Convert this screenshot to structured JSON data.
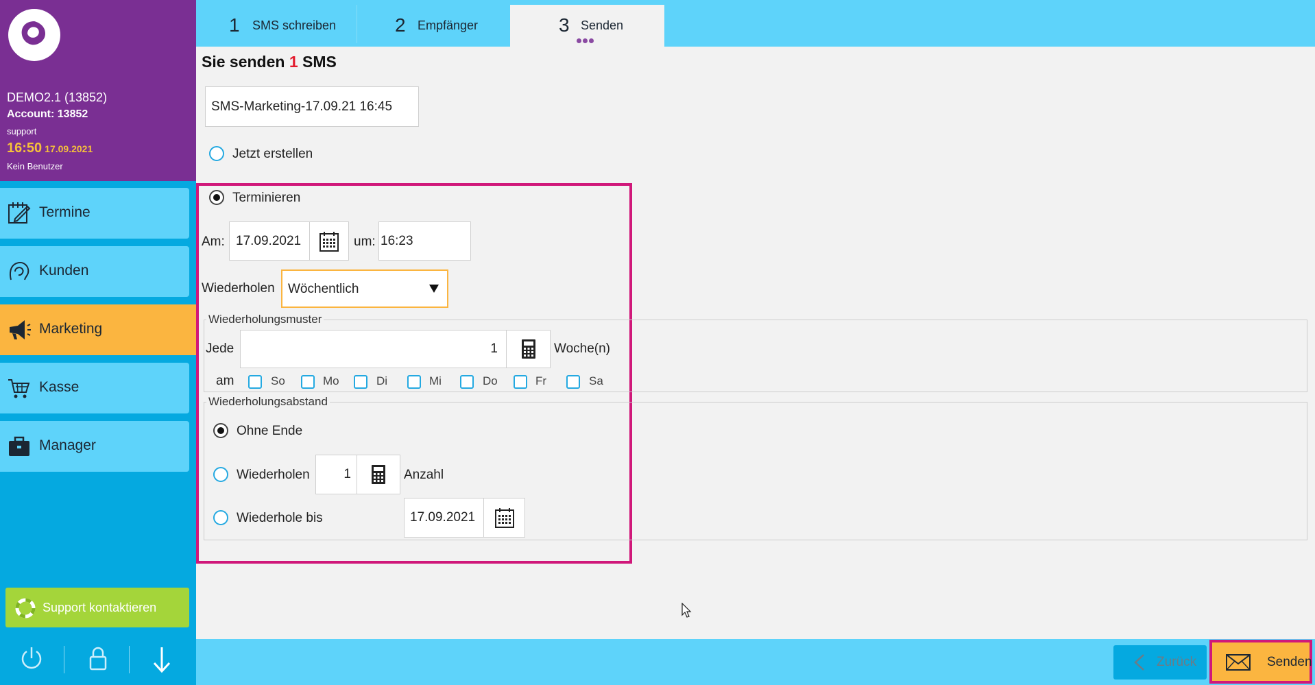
{
  "sidebar": {
    "account": {
      "name": "DEMO2.1 (13852)",
      "account_line": "Account: 13852",
      "user": "support",
      "time": "16:50",
      "date": "17.09.2021",
      "no_user": "Kein Benutzer"
    },
    "items": [
      {
        "label": "Termine",
        "icon": "calendar-edit-icon"
      },
      {
        "label": "Kunden",
        "icon": "customer-head-icon"
      },
      {
        "label": "Marketing",
        "icon": "megaphone-icon"
      },
      {
        "label": "Kasse",
        "icon": "shopping-cart-icon"
      },
      {
        "label": "Manager",
        "icon": "briefcase-icon"
      }
    ],
    "support_label": "Support kontaktieren",
    "bottom_icons": [
      "power-icon",
      "lock-icon",
      "download-arrow-icon"
    ]
  },
  "tabs": [
    {
      "num": "1",
      "label": "SMS schreiben"
    },
    {
      "num": "2",
      "label": "Empfänger"
    },
    {
      "num": "3",
      "label": "Senden"
    }
  ],
  "main": {
    "title_prefix": "Sie senden ",
    "title_count": "1",
    "title_suffix": " SMS",
    "campaign_name": "SMS-Marketing-17.09.21 16:45",
    "now_label": "Jetzt erstellen",
    "schedule_label": "Terminieren",
    "date_label": "Am:",
    "date_value": "17.09.2021",
    "time_label": "um:",
    "time_value": "16:23",
    "repeat_label": "Wiederholen",
    "repeat_value": "Wöchentlich",
    "pattern": {
      "title": "Wiederholungsmuster",
      "every_label": "Jede",
      "every_value": "1",
      "unit": "Woche(n)",
      "on_label": "am",
      "days": [
        "So",
        "Mo",
        "Di",
        "Mi",
        "Do",
        "Fr",
        "Sa"
      ]
    },
    "range": {
      "title": "Wiederholungsabstand",
      "no_end": "Ohne Ende",
      "repeat_label": "Wiederholen",
      "repeat_count": "1",
      "count_label": "Anzahl",
      "until_label": "Wiederhole bis",
      "until_value": "17.09.2021"
    }
  },
  "footer": {
    "back_label": "Zurück",
    "send_label": "Senden"
  },
  "colors": {
    "sidebar_header": "#7a2f93",
    "sidebar": "#05a9e0",
    "nav_item": "#5ed3fa",
    "active": "#fbb540",
    "highlight": "#d0187a",
    "support": "#a4d53a"
  }
}
